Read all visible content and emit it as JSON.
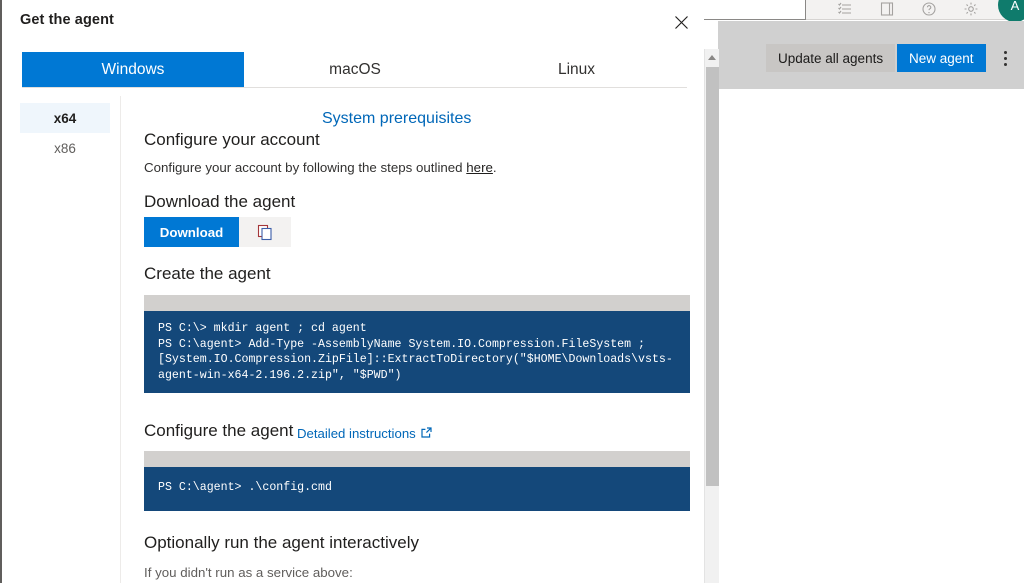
{
  "background": {
    "buttons": {
      "update_all_agents": "Update all agents",
      "new_agent": "New agent"
    },
    "icons": {
      "more": "more-vertical-icon",
      "list": "list-icon",
      "notebook": "notebook-icon",
      "help": "help-circle-icon",
      "settings": "gear-icon",
      "avatar_initial": "A"
    }
  },
  "dialog": {
    "title": "Get the agent",
    "close_label": "Close",
    "tabs": [
      {
        "label": "Windows",
        "active": true
      },
      {
        "label": "macOS",
        "active": false
      },
      {
        "label": "Linux",
        "active": false
      }
    ],
    "architectures": [
      {
        "label": "x64",
        "active": true
      },
      {
        "label": "x86",
        "active": false
      }
    ],
    "prerequisites_link": "System prerequisites",
    "sections": {
      "configure_account": {
        "heading": "Configure your account",
        "text_before": "Configure your account by following the steps outlined ",
        "link": "here",
        "text_after": "."
      },
      "download": {
        "heading": "Download the agent",
        "button": "Download",
        "copy_icon": "copy-icon"
      },
      "create": {
        "heading": "Create the agent",
        "code": "PS C:\\> mkdir agent ; cd agent\nPS C:\\agent> Add-Type -AssemblyName System.IO.Compression.FileSystem ;\n[System.IO.Compression.ZipFile]::ExtractToDirectory(\"$HOME\\Downloads\\vsts-\nagent-win-x64-2.196.2.zip\", \"$PWD\")"
      },
      "configure_agent": {
        "heading": "Configure the agent",
        "link": "Detailed instructions",
        "link_icon": "external-link-icon",
        "code": "PS C:\\agent> .\\config.cmd"
      },
      "optional_run": {
        "heading": "Optionally run the agent interactively",
        "text": "If you didn't run as a service above:"
      }
    }
  },
  "colors": {
    "accent": "#0078d4",
    "link": "#0067b8",
    "code_bg": "#14487a",
    "code_bar": "#d2d0ce",
    "avatar": "#0f7b6c"
  }
}
